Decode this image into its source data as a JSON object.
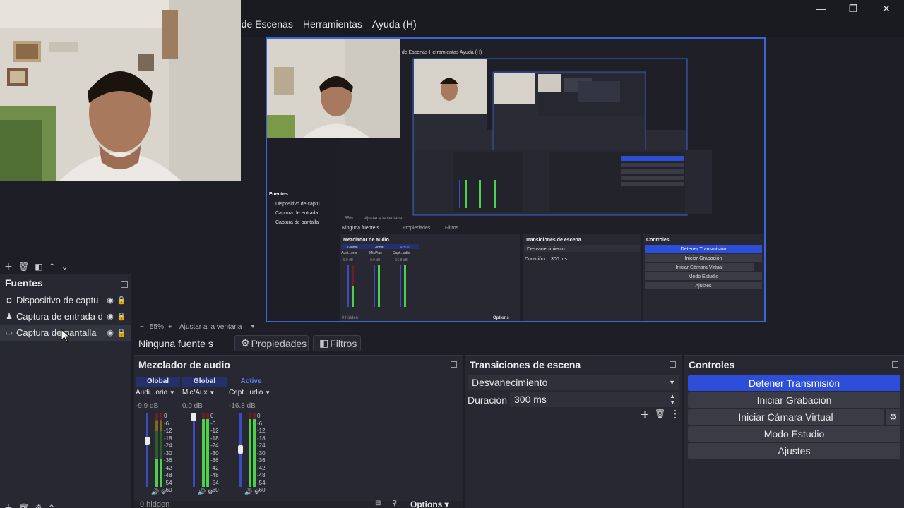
{
  "menu": {
    "items": [
      "n de Escenas",
      "Herramientas",
      "Ayuda (H)"
    ]
  },
  "window_controls": {
    "minimize": "—",
    "maximize": "❐",
    "close": "✕"
  },
  "sources": {
    "title": "Fuentes",
    "items": [
      {
        "label": "Dispositivo de captu",
        "icon": "camera-icon"
      },
      {
        "label": "Captura de entrada d",
        "icon": "microphone-icon"
      },
      {
        "label": "Captura de pantalla",
        "icon": "monitor-icon"
      }
    ]
  },
  "preview": {
    "zoom": "55%",
    "fit_label": "Ajustar a la ventana"
  },
  "context_bar": {
    "no_source": "Ninguna fuente s",
    "properties": "Propiedades",
    "filters": "Filtros"
  },
  "mixer": {
    "title": "Mezclador de audio",
    "channels": [
      {
        "tag": "Global",
        "name": "Audi...orio",
        "db": "-9.9 dB",
        "level": 0.38,
        "fader": 0.68
      },
      {
        "tag": "Global",
        "name": "Mic/Aux",
        "db": "0.0 dB",
        "level": 0.92,
        "fader": 1.0
      },
      {
        "tag": "Active",
        "name": "Capt...udio",
        "db": "-16.8 dB",
        "level": 0.92,
        "fader": 0.55
      }
    ],
    "scale": [
      "0",
      "-6",
      "-12",
      "-18",
      "-24",
      "-30",
      "-36",
      "-42",
      "-48",
      "-54",
      "-60"
    ],
    "hidden": "0 hidden",
    "options": "Options"
  },
  "transitions": {
    "title": "Transiciones de escena",
    "selected": "Desvanecimiento",
    "duration_label": "Duración",
    "duration_value": "300 ms"
  },
  "controls": {
    "title": "Controles",
    "buttons": [
      {
        "label": "Detener Transmisión",
        "active": true
      },
      {
        "label": "Iniciar Grabación",
        "active": false
      },
      {
        "label": "Iniciar Cámara Virtual",
        "active": false
      },
      {
        "label": "Modo Estudio",
        "active": false
      },
      {
        "label": "Ajustes",
        "active": false
      }
    ]
  },
  "nested_preview": {
    "menu": "n de Escenas  Herramientas  Ayuda (H)",
    "sources_title": "Fuentes",
    "sources": [
      "Dispositivo de captu",
      "Captura de entrada",
      "Captura de pantalla"
    ],
    "zoom": "55%",
    "fit_label": "Ajustar a la ventana",
    "no_source": "Ninguna fuente s",
    "properties": "Propiedades",
    "filters": "Filtros",
    "mixer_title": "Mezclador de audio",
    "mixer_tags": [
      "Global",
      "Global",
      "Active"
    ],
    "mixer_names": [
      "Audi...orio",
      "Mic/Aux",
      "Capt...udio"
    ],
    "mixer_db": [
      "-9.9 dB",
      "0.0 dB",
      "-16.8 dB"
    ],
    "hidden": "0 hidden",
    "options": "Options",
    "transitions_title": "Transiciones de escena",
    "transition": "Desvanecimiento",
    "duration_label": "Duración",
    "duration_value": "300 ms",
    "controls_title": "Controles",
    "controls": [
      "Detener Transmisión",
      "Iniciar Grabación",
      "Iniciar Cámara Virtual",
      "Modo Estudio",
      "Ajustes"
    ]
  },
  "colors": {
    "accent": "#2c4ed8",
    "panel_bg": "#272832",
    "window_bg": "#1e1f26",
    "meter_green": "#4cd14c",
    "fader_blue": "#3b4cc0"
  }
}
